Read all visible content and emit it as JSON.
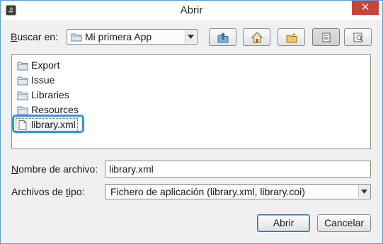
{
  "window": {
    "title": "Abrir",
    "close_glyph": "✕"
  },
  "lookin": {
    "label": "Buscar en:",
    "value": "Mi primera App"
  },
  "toolbar": {
    "buttons": [
      {
        "name": "up-one-level-icon"
      },
      {
        "name": "home-icon"
      },
      {
        "name": "new-folder-icon"
      },
      {
        "name": "list-view-icon"
      },
      {
        "name": "details-view-icon"
      }
    ]
  },
  "files": [
    {
      "name": "Export",
      "type": "folder"
    },
    {
      "name": "Issue",
      "type": "folder"
    },
    {
      "name": "Libraries",
      "type": "folder"
    },
    {
      "name": "Resources",
      "type": "folder"
    },
    {
      "name": "library.xml",
      "type": "file",
      "selected": true
    }
  ],
  "filename": {
    "label": "Nombre de archivo:",
    "value": "library.xml"
  },
  "filetype": {
    "label": "Archivos de tipo:",
    "value": "Fichero de aplicación (library.xml, library.coi)"
  },
  "actions": {
    "open": "Abrir",
    "cancel": "Cancelar"
  },
  "colors": {
    "highlight": "#2d9ad1",
    "close": "#c7443b",
    "default_border": "#2f6fa8"
  }
}
